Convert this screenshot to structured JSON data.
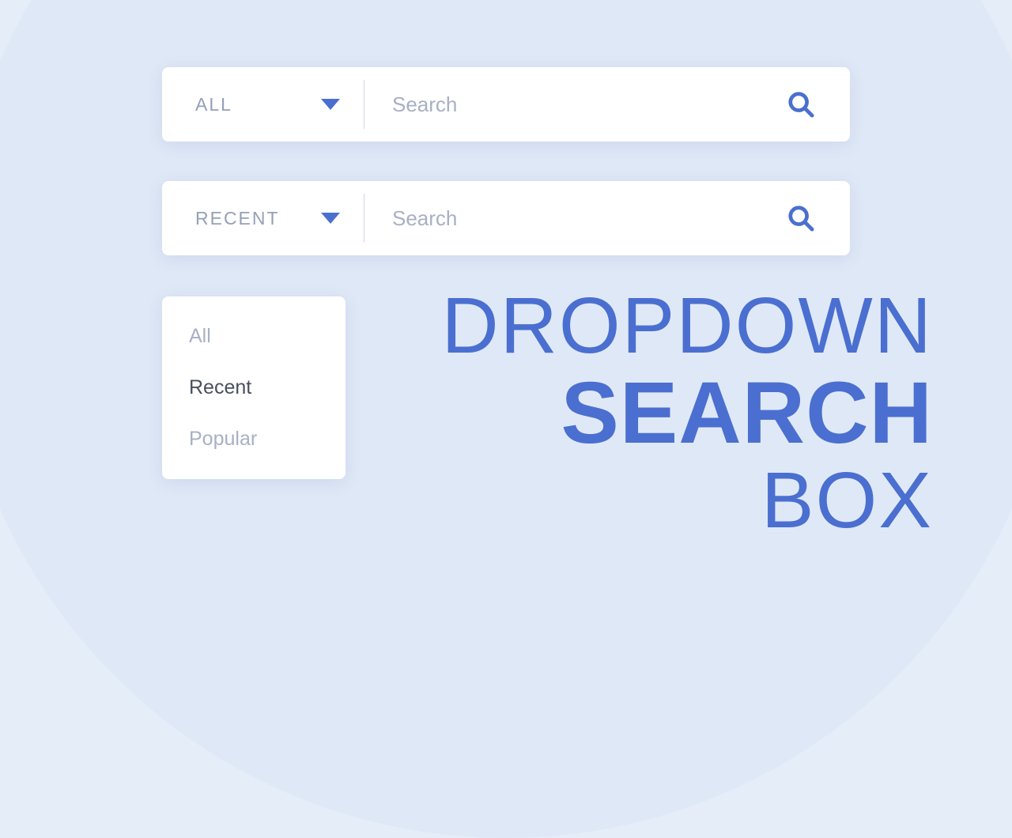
{
  "searchBoxes": [
    {
      "selected": "ALL",
      "placeholder": "Search"
    },
    {
      "selected": "RECENT",
      "placeholder": "Search"
    }
  ],
  "dropdown": {
    "items": [
      {
        "label": "All",
        "selected": false
      },
      {
        "label": "Recent",
        "selected": true
      },
      {
        "label": "Popular",
        "selected": false
      }
    ]
  },
  "title": {
    "line1": "DROPDOWN",
    "line2": "SEARCH",
    "line3": "BOX"
  }
}
